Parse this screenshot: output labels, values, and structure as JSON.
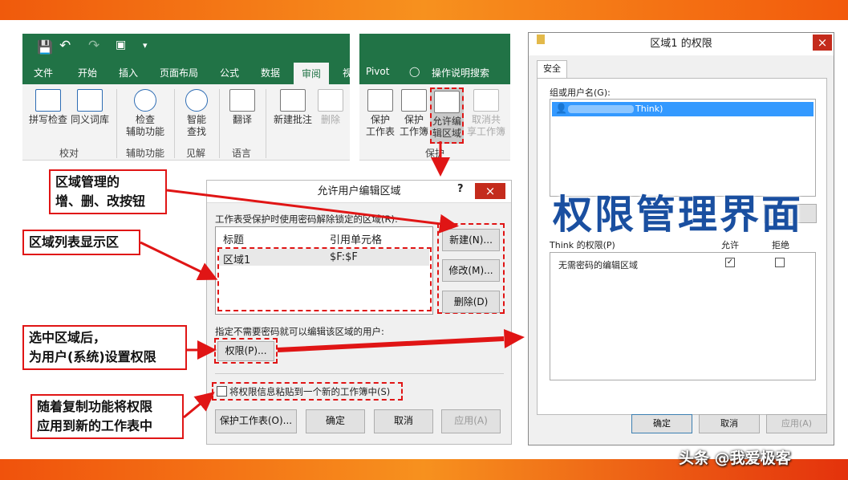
{
  "excel": {
    "qat_icons": [
      "save-icon",
      "undo-icon",
      "redo-icon",
      "touch-mode-icon",
      "customize-icon"
    ],
    "tabs": [
      "文件",
      "开始",
      "插入",
      "页面布局",
      "公式",
      "数据",
      "审阅",
      "视",
      "Pivot",
      "操作说明搜索"
    ],
    "active_tab": "审阅",
    "ribbon": {
      "spell": "拼写检查",
      "thesaurus": "同义词库",
      "group_proof": "校对",
      "accessibility_1": "检查",
      "accessibility_2": "辅助功能",
      "group_access": "辅助功能",
      "smart_1": "智能",
      "smart_2": "查找",
      "group_insight": "见解",
      "translate": "翻译",
      "group_lang": "语言",
      "new_comment": "新建批注",
      "delete": "删除",
      "protect_sheet_1": "保护",
      "protect_sheet_2": "工作表",
      "protect_wb_1": "保护",
      "protect_wb_2": "工作簿",
      "allow_edit_1": "允许编",
      "allow_edit_2": "辑区域",
      "unshare_1": "取消共",
      "unshare_2": "享工作簿",
      "group_protect": "保护"
    }
  },
  "notes": {
    "n1_line1": "区域管理的",
    "n1_line2": "增、删、改按钮",
    "n2": "区域列表显示区",
    "n3_line1": "选中区域后，",
    "n3_line2": "为用户(系统)设置权限",
    "n4_line1": "随着复制功能将权限",
    "n4_line2": "应用到新的工作表中"
  },
  "allow_dialog": {
    "title": "允许用户编辑区域",
    "help": "?",
    "close": "×",
    "desc": "工作表受保护时使用密码解除锁定的区域(R):",
    "col_title": "标题",
    "col_ref": "引用单元格",
    "rows": [
      {
        "title": "区域1",
        "ref": "$F:$F"
      }
    ],
    "btn_new": "新建(N)...",
    "btn_modify": "修改(M)...",
    "btn_delete": "删除(D)",
    "users_desc": "指定不需要密码就可以编辑该区域的用户:",
    "btn_perm": "权限(P)...",
    "paste_label": "将权限信息粘贴到一个新的工作簿中(S)",
    "btn_protect": "保护工作表(O)...",
    "btn_ok": "确定",
    "btn_cancel": "取消",
    "btn_apply": "应用(A)"
  },
  "perm_dialog": {
    "title": "区域1 的权限",
    "close": "×",
    "tab": "安全",
    "group_label": "组或用户名(G):",
    "user": "Think)",
    "perm_label": "Think 的权限(P)",
    "col_allow": "允许",
    "col_deny": "拒绝",
    "perms": [
      {
        "name": "无需密码的编辑区域",
        "allow": true,
        "deny": false
      }
    ],
    "btn_ok": "确定",
    "btn_cancel": "取消",
    "btn_apply": "应用(A)"
  },
  "watermark": "权限管理界面",
  "footer": "头条 @我爱极客"
}
